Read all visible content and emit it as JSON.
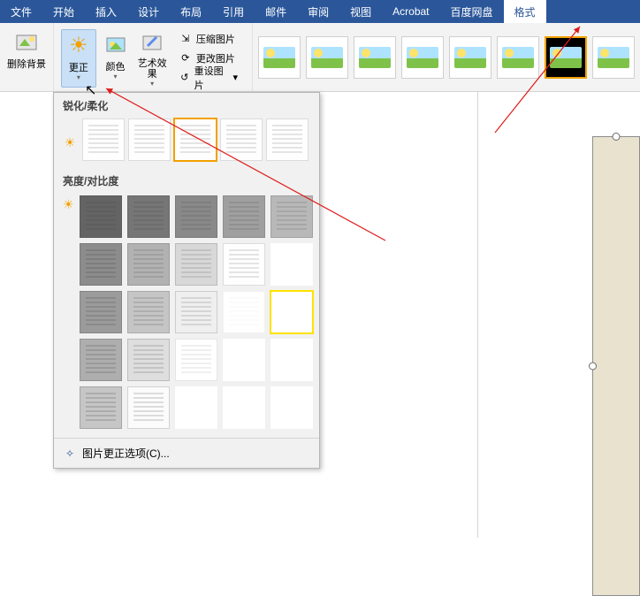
{
  "tabs": {
    "items": [
      "文件",
      "开始",
      "插入",
      "设计",
      "布局",
      "引用",
      "邮件",
      "审阅",
      "视图",
      "Acrobat",
      "百度网盘",
      "格式"
    ],
    "active_index": 11
  },
  "ribbon": {
    "remove_bg": "删除背景",
    "corrections": "更正",
    "color": "颜色",
    "artistic": "艺术效果",
    "compress": "压缩图片",
    "change": "更改图片",
    "reset": "重设图片"
  },
  "dropdown": {
    "sharpen_header": "锐化/柔化",
    "brightness_header": "亮度/对比度",
    "options": "图片更正选项(C)..."
  },
  "icons": {
    "sun": "☀",
    "palette": "🎨",
    "brush": "✎",
    "compress": "⇲",
    "change": "⟳",
    "reset": "↺",
    "caret": "▾",
    "wand": "✧"
  }
}
